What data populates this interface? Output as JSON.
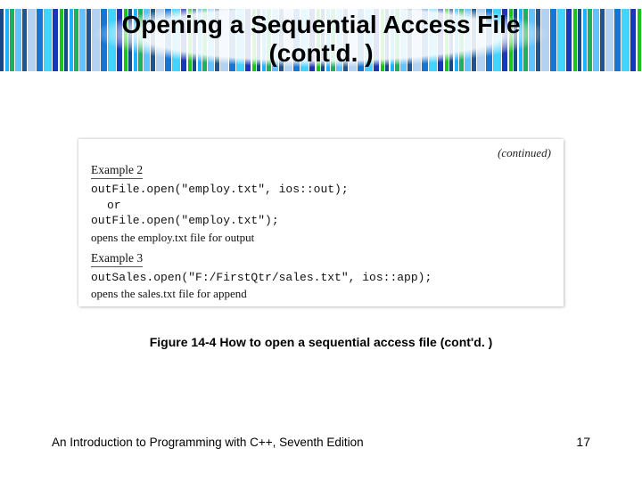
{
  "title_line1": "Opening a Sequential Access File",
  "title_line2": "(cont'd. )",
  "continued_label": "(continued)",
  "example2": {
    "heading": "Example 2",
    "code_line1": "outFile.open(\"employ.txt\", ios::out);",
    "or_word": "or",
    "code_line2": "outFile.open(\"employ.txt\");",
    "note": "opens the employ.txt file for output"
  },
  "example3": {
    "heading": "Example 3",
    "code_line1": "outSales.open(\"F:/FirstQtr/sales.txt\", ios::app);",
    "note": "opens the sales.txt file for append"
  },
  "caption": "Figure 14-4 How to open a sequential access file (cont'd. )",
  "footer_left": "An Introduction to Programming with C++, Seventh Edition",
  "page_number": "17"
}
